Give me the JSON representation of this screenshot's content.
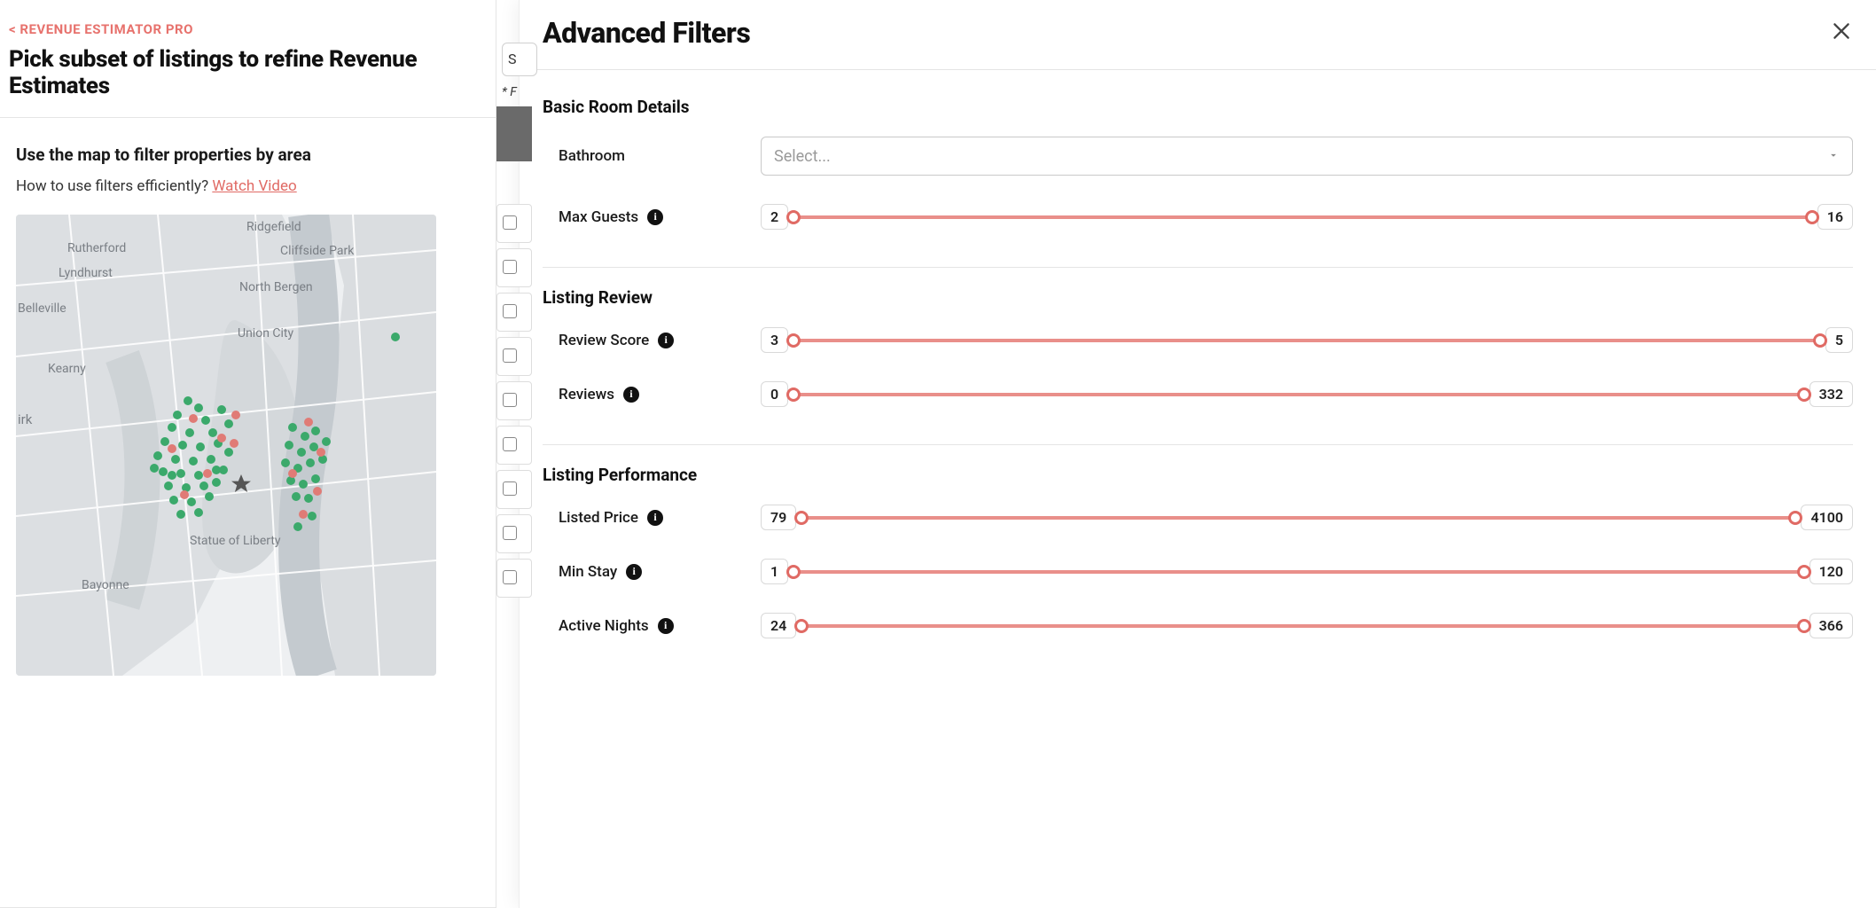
{
  "breadcrumb": "< REVENUE ESTIMATOR PRO",
  "page_title": "Pick subset of listings to refine Revenue Estimates",
  "map": {
    "title": "Use the map to filter properties by area",
    "helper_prefix": "How to use filters efficiently? ",
    "helper_link": "Watch Video",
    "labels": {
      "ridgefield": "Ridgefield",
      "cliffside": "Cliffside Park",
      "rutherford": "Rutherford",
      "lyndhurst": "Lyndhurst",
      "northbergen": "North Bergen",
      "belleville": "Belleville",
      "unioncity": "Union City",
      "kearny": "Kearny",
      "irk": "irk",
      "liberty": "Statue of Liberty",
      "bayonne": "Bayonne"
    }
  },
  "peek": {
    "search_initial": "S",
    "legend_initial": "* F"
  },
  "drawer": {
    "title": "Advanced Filters",
    "sections": {
      "basic": {
        "title": "Basic Room Details",
        "bathroom_label": "Bathroom",
        "bathroom_placeholder": "Select...",
        "max_guests_label": "Max Guests",
        "max_guests_min": "2",
        "max_guests_max": "16"
      },
      "review": {
        "title": "Listing Review",
        "score_label": "Review Score",
        "score_min": "3",
        "score_max": "5",
        "reviews_label": "Reviews",
        "reviews_min": "0",
        "reviews_max": "332"
      },
      "perf": {
        "title": "Listing Performance",
        "price_label": "Listed Price",
        "price_min": "79",
        "price_max": "4100",
        "minstay_label": "Min Stay",
        "minstay_min": "1",
        "minstay_max": "120",
        "active_label": "Active Nights",
        "active_min": "24",
        "active_max": "366"
      }
    }
  }
}
